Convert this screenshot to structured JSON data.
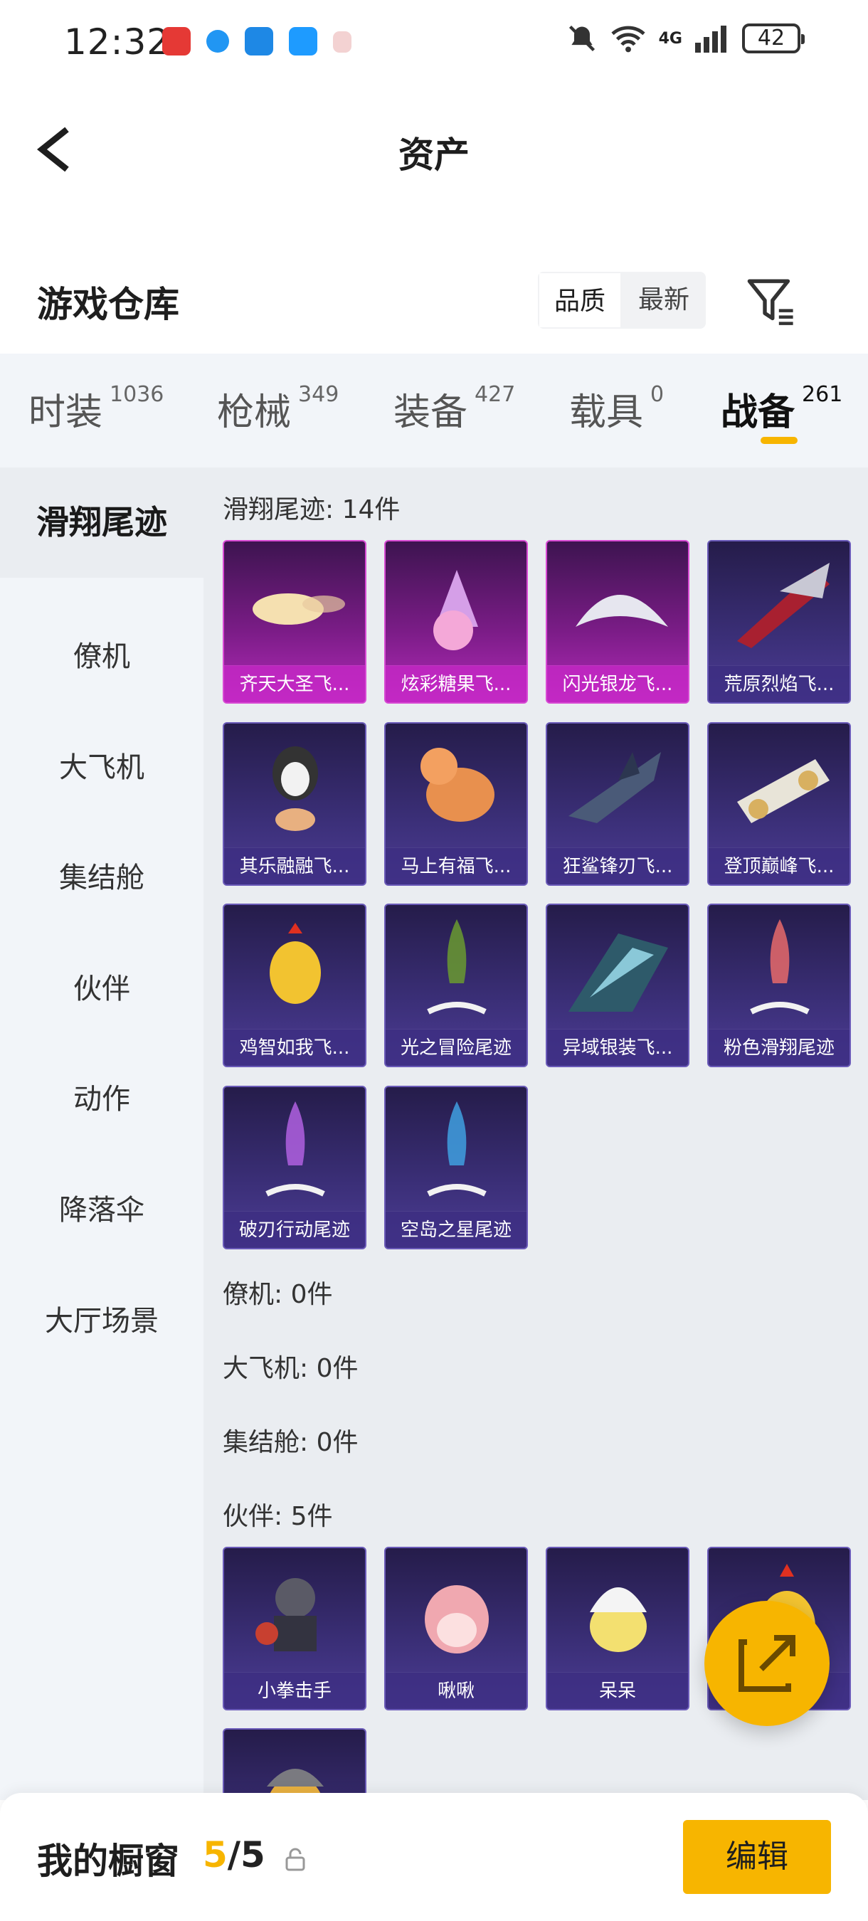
{
  "status_bar": {
    "time": "12:32",
    "battery": "42",
    "signal": "4G"
  },
  "header": {
    "title": "资产"
  },
  "section": {
    "title": "游戏仓库",
    "sort_options": [
      "品质",
      "最新"
    ]
  },
  "tabs": [
    {
      "label": "时装",
      "count": "1036"
    },
    {
      "label": "枪械",
      "count": "349"
    },
    {
      "label": "装备",
      "count": "427"
    },
    {
      "label": "载具",
      "count": "0"
    },
    {
      "label": "战备",
      "count": "261",
      "active": true
    }
  ],
  "sidebar": {
    "items": [
      {
        "label": "滑翔尾迹",
        "active": true
      },
      {
        "label": "僚机"
      },
      {
        "label": "大飞机"
      },
      {
        "label": "集结舱"
      },
      {
        "label": "伙伴"
      },
      {
        "label": "动作"
      },
      {
        "label": "降落伞"
      },
      {
        "label": "大厅场景"
      }
    ]
  },
  "groups": {
    "glide": {
      "title": "滑翔尾迹: 14件",
      "items": [
        {
          "name": "齐天大圣飞...",
          "rarity": "purple"
        },
        {
          "name": "炫彩糖果飞...",
          "rarity": "purple"
        },
        {
          "name": "闪光银龙飞...",
          "rarity": "purple"
        },
        {
          "name": "荒原烈焰飞...",
          "rarity": "blue"
        },
        {
          "name": "其乐融融飞...",
          "rarity": "blue"
        },
        {
          "name": "马上有福飞...",
          "rarity": "blue"
        },
        {
          "name": "狂鲨锋刃飞...",
          "rarity": "blue"
        },
        {
          "name": "登顶巅峰飞...",
          "rarity": "blue"
        },
        {
          "name": "鸡智如我飞...",
          "rarity": "blue"
        },
        {
          "name": "光之冒险尾迹",
          "rarity": "blue"
        },
        {
          "name": "异域银装飞...",
          "rarity": "blue"
        },
        {
          "name": "粉色滑翔尾迹",
          "rarity": "blue"
        },
        {
          "name": "破刃行动尾迹",
          "rarity": "blue"
        },
        {
          "name": "空岛之星尾迹",
          "rarity": "blue"
        }
      ]
    },
    "wingman": {
      "title": "僚机: 0件"
    },
    "bigplane": {
      "title": "大飞机: 0件"
    },
    "pod": {
      "title": "集结舱: 0件"
    },
    "partner": {
      "title": "伙伴: 5件",
      "items": [
        {
          "name": "小拳击手"
        },
        {
          "name": "啾啾"
        },
        {
          "name": "呆呆"
        },
        {
          "name": ""
        },
        {
          "name": ""
        }
      ]
    }
  },
  "bottom_bar": {
    "title": "我的橱窗",
    "count_current": "5",
    "count_total": "/5",
    "edit_label": "编辑"
  },
  "colors": {
    "accent": "#f7b500",
    "card_blue": "#3b2f78",
    "card_purple": "#b22ab8"
  }
}
